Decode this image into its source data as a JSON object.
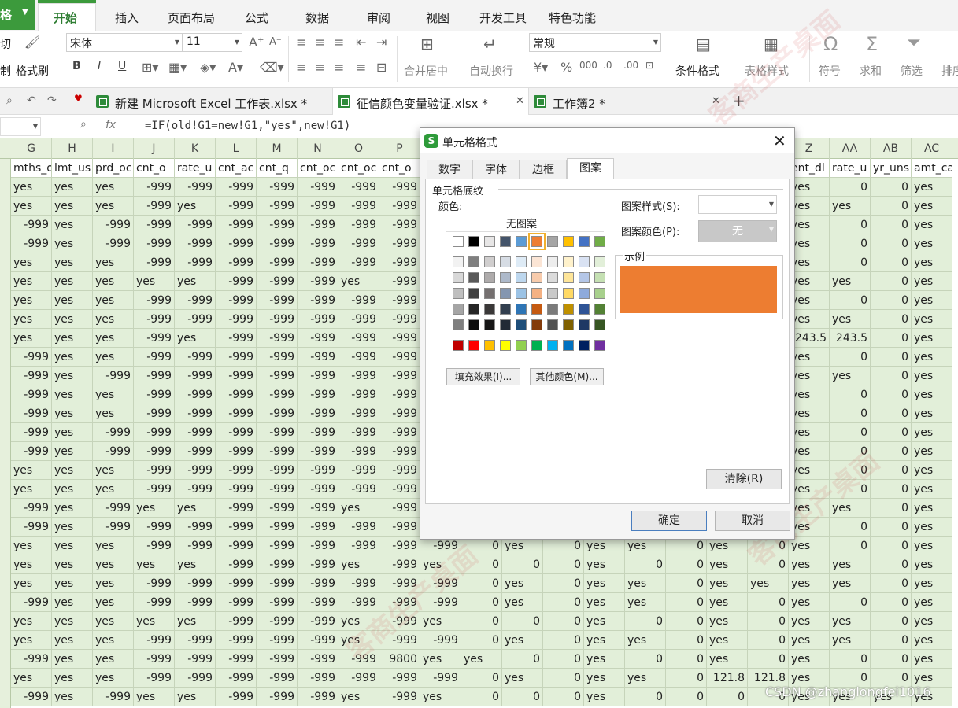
{
  "ribbon": {
    "app_menu": "格",
    "tabs": [
      "开始",
      "插入",
      "页面布局",
      "公式",
      "数据",
      "审阅",
      "视图",
      "开发工具",
      "特色功能"
    ],
    "active_tab": "开始"
  },
  "toolbar": {
    "cut_label": "切",
    "paste_label": "制",
    "format_painter": "格式刷",
    "font_name": "宋体",
    "font_size": "11",
    "bold": "B",
    "italic": "I",
    "underline": "U",
    "merge_center": "合并居中",
    "wrap_text": "自动换行",
    "number_format": "常规",
    "conditional_format": "条件格式",
    "table_style": "表格样式",
    "symbol": "符号",
    "sum": "求和",
    "filter": "筛选",
    "sort": "排序"
  },
  "document_tabs": [
    {
      "label": "新建 Microsoft Excel 工作表.xlsx *"
    },
    {
      "label": "征信颜色变量验证.xlsx *"
    },
    {
      "label": "工作簿2 *"
    }
  ],
  "formula_bar": {
    "fx": "fx",
    "formula": "=IF(old!G1=new!G1,\"yes\",new!G1)"
  },
  "grid": {
    "columns": [
      "G",
      "H",
      "I",
      "J",
      "K",
      "L",
      "M",
      "N",
      "O",
      "P",
      "Q",
      "R",
      "S",
      "T",
      "U",
      "V",
      "W",
      "X",
      "Y",
      "Z",
      "AA",
      "AB",
      "AC"
    ],
    "header_row": [
      "mths_o",
      "lmt_us",
      "prd_oc",
      "cnt_o",
      "rate_u",
      "cnt_ac",
      "cnt_q",
      "cnt_oc",
      "cnt_oc",
      "cnt_o",
      "",
      "",
      "",
      "",
      "",
      "",
      "",
      "",
      "",
      "ent_dl",
      "rate_u",
      "yr_uns",
      "amt_ca"
    ],
    "rows": [
      [
        "yes",
        "yes",
        "yes",
        "-999",
        "-999",
        "-999",
        "-999",
        "-999",
        "-999",
        "-999",
        "",
        "",
        "",
        "",
        "",
        "",
        "",
        "",
        "",
        "yes",
        "0",
        "0",
        "yes"
      ],
      [
        "yes",
        "yes",
        "yes",
        "-999",
        "yes",
        "-999",
        "-999",
        "-999",
        "-999",
        "-999",
        "",
        "",
        "",
        "",
        "",
        "",
        "",
        "",
        "",
        "yes",
        "yes",
        "0",
        "yes"
      ],
      [
        "-999",
        "yes",
        "-999",
        "-999",
        "-999",
        "-999",
        "-999",
        "-999",
        "-999",
        "-999",
        "",
        "",
        "",
        "",
        "",
        "",
        "",
        "",
        "",
        "yes",
        "0",
        "0",
        "yes"
      ],
      [
        "-999",
        "yes",
        "-999",
        "-999",
        "-999",
        "-999",
        "-999",
        "-999",
        "-999",
        "-999",
        "",
        "",
        "",
        "",
        "",
        "",
        "",
        "",
        "",
        "yes",
        "0",
        "0",
        "yes"
      ],
      [
        "yes",
        "yes",
        "yes",
        "-999",
        "-999",
        "-999",
        "-999",
        "-999",
        "-999",
        "-999",
        "",
        "",
        "",
        "",
        "",
        "",
        "",
        "",
        "",
        "yes",
        "0",
        "0",
        "yes"
      ],
      [
        "yes",
        "yes",
        "yes",
        "yes",
        "yes",
        "-999",
        "-999",
        "-999",
        "yes",
        "-999",
        "",
        "",
        "",
        "",
        "",
        "",
        "",
        "",
        "",
        "yes",
        "yes",
        "0",
        "yes"
      ],
      [
        "yes",
        "yes",
        "yes",
        "-999",
        "-999",
        "-999",
        "-999",
        "-999",
        "-999",
        "-999",
        "",
        "",
        "",
        "",
        "",
        "",
        "",
        "",
        "",
        "yes",
        "0",
        "0",
        "yes"
      ],
      [
        "yes",
        "yes",
        "yes",
        "-999",
        "-999",
        "-999",
        "-999",
        "-999",
        "-999",
        "-999",
        "",
        "",
        "",
        "",
        "",
        "",
        "",
        "",
        "",
        "yes",
        "yes",
        "0",
        "yes"
      ],
      [
        "yes",
        "yes",
        "yes",
        "-999",
        "yes",
        "-999",
        "-999",
        "-999",
        "-999",
        "-999",
        "",
        "",
        "",
        "",
        "",
        "",
        "",
        "",
        "",
        "243.5",
        "243.5",
        "0",
        "yes"
      ],
      [
        "-999",
        "yes",
        "yes",
        "-999",
        "-999",
        "-999",
        "-999",
        "-999",
        "-999",
        "-999",
        "",
        "",
        "",
        "",
        "",
        "",
        "",
        "",
        "",
        "yes",
        "0",
        "0",
        "yes"
      ],
      [
        "-999",
        "yes",
        "-999",
        "-999",
        "-999",
        "-999",
        "-999",
        "-999",
        "-999",
        "-999",
        "",
        "",
        "",
        "",
        "",
        "",
        "",
        "",
        "",
        "yes",
        "yes",
        "0",
        "yes"
      ],
      [
        "-999",
        "yes",
        "yes",
        "-999",
        "-999",
        "-999",
        "-999",
        "-999",
        "-999",
        "-999",
        "",
        "",
        "",
        "",
        "",
        "",
        "",
        "",
        "",
        "yes",
        "0",
        "0",
        "yes"
      ],
      [
        "-999",
        "yes",
        "yes",
        "-999",
        "-999",
        "-999",
        "-999",
        "-999",
        "-999",
        "-999",
        "",
        "",
        "",
        "",
        "",
        "",
        "",
        "",
        "",
        "yes",
        "0",
        "0",
        "yes"
      ],
      [
        "-999",
        "yes",
        "-999",
        "-999",
        "-999",
        "-999",
        "-999",
        "-999",
        "-999",
        "-999",
        "",
        "",
        "",
        "",
        "",
        "",
        "",
        "",
        "",
        "yes",
        "0",
        "0",
        "yes"
      ],
      [
        "-999",
        "yes",
        "-999",
        "-999",
        "-999",
        "-999",
        "-999",
        "-999",
        "-999",
        "-999",
        "",
        "",
        "",
        "",
        "",
        "",
        "",
        "",
        "",
        "yes",
        "0",
        "0",
        "yes"
      ],
      [
        "yes",
        "yes",
        "yes",
        "-999",
        "-999",
        "-999",
        "-999",
        "-999",
        "-999",
        "-999",
        "",
        "",
        "",
        "",
        "",
        "",
        "",
        "",
        "",
        "yes",
        "0",
        "0",
        "yes"
      ],
      [
        "yes",
        "yes",
        "yes",
        "-999",
        "-999",
        "-999",
        "-999",
        "-999",
        "-999",
        "-999",
        "",
        "",
        "",
        "",
        "",
        "",
        "",
        "",
        "",
        "yes",
        "0",
        "0",
        "yes"
      ],
      [
        "-999",
        "yes",
        "-999",
        "yes",
        "yes",
        "-999",
        "-999",
        "-999",
        "yes",
        "-999",
        "",
        "",
        "",
        "",
        "",
        "",
        "",
        "",
        "",
        "yes",
        "yes",
        "0",
        "yes"
      ],
      [
        "-999",
        "yes",
        "-999",
        "-999",
        "-999",
        "-999",
        "-999",
        "-999",
        "-999",
        "-999",
        "",
        "",
        "",
        "",
        "",
        "",
        "",
        "",
        "",
        "yes",
        "0",
        "0",
        "yes"
      ],
      [
        "yes",
        "yes",
        "yes",
        "-999",
        "-999",
        "-999",
        "-999",
        "-999",
        "-999",
        "-999",
        "-999",
        "0",
        "yes",
        "0",
        "yes",
        "yes",
        "0",
        "yes",
        "0",
        "yes",
        "0",
        "0",
        "yes"
      ],
      [
        "yes",
        "yes",
        "yes",
        "yes",
        "yes",
        "-999",
        "-999",
        "-999",
        "yes",
        "-999",
        "yes",
        "0",
        "0",
        "0",
        "yes",
        "0",
        "0",
        "yes",
        "0",
        "yes",
        "yes",
        "0",
        "yes"
      ],
      [
        "yes",
        "yes",
        "yes",
        "-999",
        "-999",
        "-999",
        "-999",
        "-999",
        "-999",
        "-999",
        "-999",
        "0",
        "yes",
        "0",
        "yes",
        "yes",
        "0",
        "yes",
        "yes",
        "yes",
        "yes",
        "0",
        "yes"
      ],
      [
        "-999",
        "yes",
        "yes",
        "-999",
        "-999",
        "-999",
        "-999",
        "-999",
        "-999",
        "-999",
        "-999",
        "0",
        "yes",
        "0",
        "yes",
        "yes",
        "0",
        "yes",
        "0",
        "yes",
        "0",
        "0",
        "yes"
      ],
      [
        "yes",
        "yes",
        "yes",
        "yes",
        "yes",
        "-999",
        "-999",
        "-999",
        "yes",
        "-999",
        "yes",
        "0",
        "0",
        "0",
        "yes",
        "0",
        "0",
        "yes",
        "0",
        "yes",
        "yes",
        "0",
        "yes"
      ],
      [
        "yes",
        "yes",
        "yes",
        "-999",
        "-999",
        "-999",
        "-999",
        "-999",
        "yes",
        "-999",
        "-999",
        "0",
        "yes",
        "0",
        "yes",
        "yes",
        "0",
        "yes",
        "0",
        "yes",
        "yes",
        "0",
        "yes"
      ],
      [
        "-999",
        "yes",
        "yes",
        "-999",
        "-999",
        "-999",
        "-999",
        "-999",
        "-999",
        "9800",
        "yes",
        "yes",
        "0",
        "0",
        "yes",
        "0",
        "0",
        "yes",
        "0",
        "yes",
        "0",
        "0",
        "yes"
      ],
      [
        "yes",
        "yes",
        "yes",
        "-999",
        "-999",
        "-999",
        "-999",
        "-999",
        "-999",
        "-999",
        "-999",
        "0",
        "yes",
        "0",
        "yes",
        "yes",
        "0",
        "121.8",
        "121.8",
        "yes",
        "0",
        "0",
        "yes"
      ],
      [
        "-999",
        "yes",
        "-999",
        "yes",
        "yes",
        "-999",
        "-999",
        "-999",
        "yes",
        "-999",
        "yes",
        "0",
        "0",
        "0",
        "yes",
        "0",
        "0",
        "0",
        "0",
        "yes",
        "yes",
        "yes",
        "yes"
      ]
    ]
  },
  "dialog": {
    "title": "单元格格式",
    "tabs": [
      "数字",
      "字体",
      "边框",
      "图案"
    ],
    "active_tab": "图案",
    "section_title": "单元格底纹",
    "color_label": "颜色:",
    "no_pattern": "无图案",
    "pattern_style_label": "图案样式(S):",
    "pattern_color_label": "图案颜色(P):",
    "pattern_color_value": "无",
    "preview_label": "示例",
    "preview_color": "#ed7d31",
    "fill_effects_button": "填充效果(I)...",
    "more_colors_button": "其他颜色(M)...",
    "clear_button": "清除(R)",
    "ok_button": "确定",
    "cancel_button": "取消",
    "palette_top": [
      "#ffffff",
      "#000000",
      "#e7e6e6",
      "#44546a",
      "#5b9bd5",
      "#ed7d31",
      "#a5a5a5",
      "#ffc000",
      "#4472c4",
      "#70ad47"
    ],
    "palette_shades": [
      [
        "#f2f2f2",
        "#7f7f7f",
        "#d0cece",
        "#d6dce4",
        "#deebf6",
        "#fbe5d5",
        "#ededed",
        "#fff2cc",
        "#d9e2f3",
        "#e2efd9"
      ],
      [
        "#d8d8d8",
        "#595959",
        "#aeabab",
        "#adb9ca",
        "#bdd7ee",
        "#f7cbac",
        "#dbdbdb",
        "#fee599",
        "#b4c6e7",
        "#c5e0b3"
      ],
      [
        "#bfbfbf",
        "#3f3f3f",
        "#757070",
        "#8496b0",
        "#9cc3e5",
        "#f4b183",
        "#c9c9c9",
        "#ffd965",
        "#8eaadb",
        "#a8d08d"
      ],
      [
        "#a5a5a5",
        "#262626",
        "#3a3838",
        "#323f4f",
        "#2e75b5",
        "#c55a11",
        "#7b7b7b",
        "#bf9000",
        "#2f5496",
        "#538135"
      ],
      [
        "#7f7f7f",
        "#0c0c0c",
        "#171616",
        "#222a35",
        "#1e4e79",
        "#833c0b",
        "#525252",
        "#7f6000",
        "#1f3864",
        "#375623"
      ]
    ],
    "palette_standard": [
      "#c00000",
      "#ff0000",
      "#ffc000",
      "#ffff00",
      "#92d050",
      "#00b050",
      "#00b0f0",
      "#0070c0",
      "#002060",
      "#7030a0"
    ],
    "selected_color": "#ed7d31"
  },
  "watermark": {
    "text": "客商生产桌面",
    "footer": "CSDN @zhanglongfei1016"
  }
}
